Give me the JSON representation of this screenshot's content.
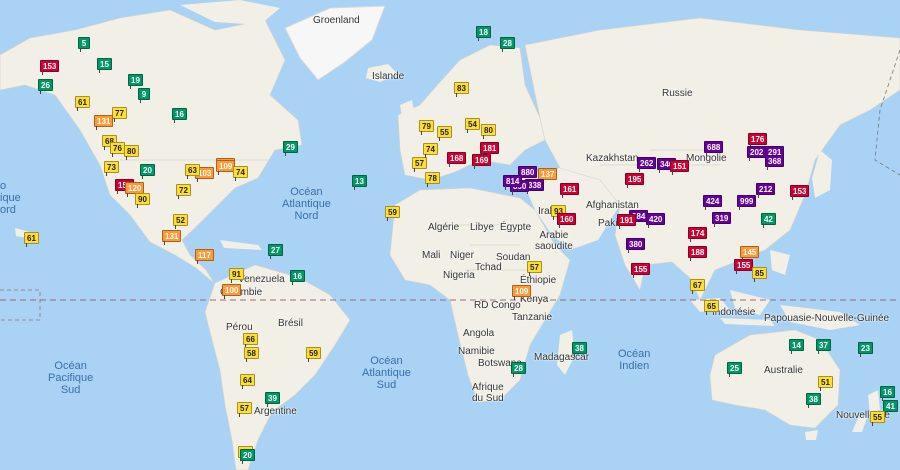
{
  "map": {
    "water_color": "#a9d2f4",
    "land_color": "#f1efe6",
    "ice_color": "#f7f7f7",
    "labels": {
      "groenland": "Groenland",
      "islande": "Islande",
      "russie": "Russie",
      "kazakhstan": "Kazakhstan",
      "mongolie": "Mongolie",
      "afghanistan": "Afghanistan",
      "pakistan": "Pakis",
      "algerie": "Algérie",
      "libye": "Libye",
      "egypte": "Égypte",
      "arabie": "Arabie\nsaoudite",
      "irak": "Irak",
      "mali": "Mali",
      "niger": "Niger",
      "tchad": "Tchad",
      "soudan": "Soudan",
      "nigeria": "Nigeria",
      "ethiopie": "Éthiopie",
      "rdcongo": "RD Congo",
      "kenya": "Kenya",
      "tanzanie": "Tanzanie",
      "angola": "Angola",
      "namibie": "Namibie",
      "botswana": "Botswana",
      "afriquesud": "Afrique\ndu Sud",
      "madagascar": "Madagascar",
      "venezuela": "Venezuela",
      "colombie": "Colombie",
      "perou": "Pérou",
      "bresil": "Brésil",
      "argentine": "Argentine",
      "indonesie": "Indonésie",
      "papouasie": "Papouasie-Nouvelle-Guinée",
      "australie": "Australie",
      "nouvellezelande": "Nouvelle-Zé",
      "ocean_atl_nord": "Océan\nAtlantique\nNord",
      "ocean_atl_sud": "Océan\nAtlantique\nSud",
      "ocean_pac_sud": "Océan\nPacifique\nSud",
      "ocean_indien": "Océan\nIndien",
      "ocean_left": "o\nique\nord"
    },
    "aqi_colors": {
      "good": "#009966",
      "moderate": "#ffde33",
      "sensitive": "#ff9933",
      "unhealthy": "#cc0033",
      "very_unhealthy": "#660099",
      "none": "#aaaaaa"
    },
    "markers": [
      {
        "v": "153",
        "c": "unhealthy"
      },
      {
        "v": "5",
        "c": "good"
      },
      {
        "v": "15",
        "c": "good"
      },
      {
        "v": "26",
        "c": "good"
      },
      {
        "v": "61",
        "c": "moderate"
      },
      {
        "v": "19",
        "c": "good"
      },
      {
        "v": "9",
        "c": "good"
      },
      {
        "v": "77",
        "c": "moderate"
      },
      {
        "v": "131",
        "c": "sensitive"
      },
      {
        "v": "16",
        "c": "good"
      },
      {
        "v": "68",
        "c": "moderate"
      },
      {
        "v": "76",
        "c": "moderate"
      },
      {
        "v": "80",
        "c": "moderate"
      },
      {
        "v": "73",
        "c": "moderate"
      },
      {
        "v": "108",
        "c": "sensitive"
      },
      {
        "v": "20",
        "c": "good"
      },
      {
        "v": "157",
        "c": "unhealthy"
      },
      {
        "v": "120",
        "c": "sensitive"
      },
      {
        "v": "90",
        "c": "moderate"
      },
      {
        "v": "103",
        "c": "sensitive"
      },
      {
        "v": "63",
        "c": "moderate"
      },
      {
        "v": "72",
        "c": "moderate"
      },
      {
        "v": "52",
        "c": "moderate"
      },
      {
        "v": "131",
        "c": "sensitive"
      },
      {
        "v": "117",
        "c": "sensitive"
      },
      {
        "v": "109",
        "c": "sensitive"
      },
      {
        "v": "74",
        "c": "moderate"
      },
      {
        "v": "29",
        "c": "good"
      },
      {
        "v": "27",
        "c": "good"
      },
      {
        "v": "13",
        "c": "good"
      },
      {
        "v": "91",
        "c": "moderate"
      },
      {
        "v": "100",
        "c": "sensitive"
      },
      {
        "v": "16",
        "c": "good"
      },
      {
        "v": "66",
        "c": "moderate"
      },
      {
        "v": "58",
        "c": "moderate"
      },
      {
        "v": "64",
        "c": "moderate"
      },
      {
        "v": "57",
        "c": "moderate"
      },
      {
        "v": "64",
        "c": "moderate"
      },
      {
        "v": "20",
        "c": "good"
      },
      {
        "v": "39",
        "c": "good"
      },
      {
        "v": "59",
        "c": "moderate"
      },
      {
        "v": "18",
        "c": "good"
      },
      {
        "v": "28",
        "c": "good"
      },
      {
        "v": "83",
        "c": "moderate"
      },
      {
        "v": "55",
        "c": "moderate"
      },
      {
        "v": "79",
        "c": "moderate"
      },
      {
        "v": "54",
        "c": "moderate"
      },
      {
        "v": "80",
        "c": "moderate"
      },
      {
        "v": "57",
        "c": "moderate"
      },
      {
        "v": "78",
        "c": "moderate"
      },
      {
        "v": "74",
        "c": "moderate"
      },
      {
        "v": "168",
        "c": "unhealthy"
      },
      {
        "v": "169",
        "c": "unhealthy"
      },
      {
        "v": "181",
        "c": "unhealthy"
      },
      {
        "v": "880",
        "c": "very_unhealthy"
      },
      {
        "v": "137",
        "c": "sensitive"
      },
      {
        "v": "338",
        "c": "very_unhealthy"
      },
      {
        "v": "890",
        "c": "very_unhealthy"
      },
      {
        "v": "814",
        "c": "very_unhealthy"
      },
      {
        "v": "161",
        "c": "unhealthy"
      },
      {
        "v": "93",
        "c": "moderate"
      },
      {
        "v": "160",
        "c": "unhealthy"
      },
      {
        "v": "59",
        "c": "moderate"
      },
      {
        "v": "57",
        "c": "moderate"
      },
      {
        "v": "109",
        "c": "sensitive"
      },
      {
        "v": "38",
        "c": "good"
      },
      {
        "v": "28",
        "c": "good"
      },
      {
        "v": "688",
        "c": "very_unhealthy"
      },
      {
        "v": "262",
        "c": "very_unhealthy"
      },
      {
        "v": "346",
        "c": "very_unhealthy"
      },
      {
        "v": "151",
        "c": "unhealthy"
      },
      {
        "v": "195",
        "c": "unhealthy"
      },
      {
        "v": "284",
        "c": "very_unhealthy"
      },
      {
        "v": "420",
        "c": "very_unhealthy"
      },
      {
        "v": "191",
        "c": "unhealthy"
      },
      {
        "v": "380",
        "c": "very_unhealthy"
      },
      {
        "v": "155",
        "c": "unhealthy"
      },
      {
        "v": "424",
        "c": "very_unhealthy"
      },
      {
        "v": "319",
        "c": "very_unhealthy"
      },
      {
        "v": "174",
        "c": "unhealthy"
      },
      {
        "v": "188",
        "c": "unhealthy"
      },
      {
        "v": "999",
        "c": "very_unhealthy"
      },
      {
        "v": "212",
        "c": "very_unhealthy"
      },
      {
        "v": "176",
        "c": "unhealthy"
      },
      {
        "v": "202",
        "c": "very_unhealthy"
      },
      {
        "v": "291",
        "c": "very_unhealthy"
      },
      {
        "v": "368",
        "c": "very_unhealthy"
      },
      {
        "v": "153",
        "c": "unhealthy"
      },
      {
        "v": "42",
        "c": "good"
      },
      {
        "v": "155",
        "c": "unhealthy"
      },
      {
        "v": "145",
        "c": "sensitive"
      },
      {
        "v": "85",
        "c": "moderate"
      },
      {
        "v": "67",
        "c": "moderate"
      },
      {
        "v": "65",
        "c": "moderate"
      },
      {
        "v": "14",
        "c": "good"
      },
      {
        "v": "37",
        "c": "good"
      },
      {
        "v": "23",
        "c": "good"
      },
      {
        "v": "25",
        "c": "good"
      },
      {
        "v": "51",
        "c": "moderate"
      },
      {
        "v": "38",
        "c": "good"
      },
      {
        "v": "16",
        "c": "good"
      },
      {
        "v": "41",
        "c": "good"
      },
      {
        "v": "55",
        "c": "moderate"
      },
      {
        "v": "61",
        "c": "moderate"
      }
    ]
  }
}
